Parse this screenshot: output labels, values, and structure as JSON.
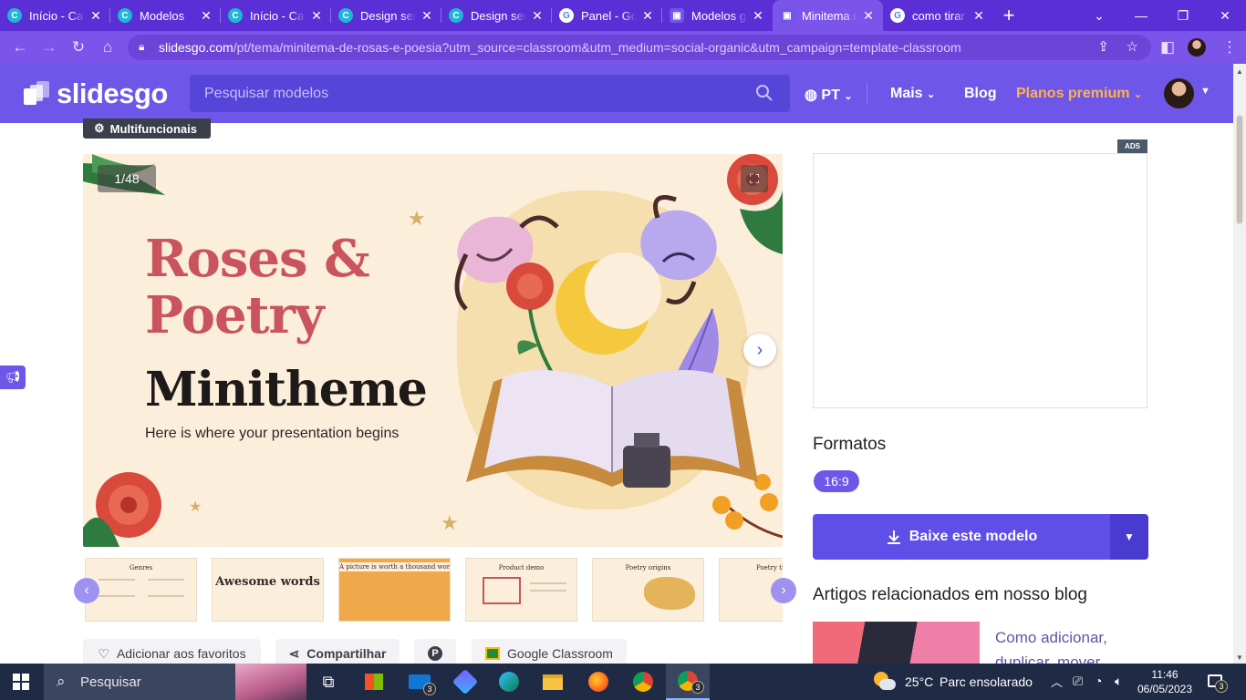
{
  "browser": {
    "tabs": [
      {
        "title": "Início - Canva",
        "icon": "canva-icon",
        "active": false
      },
      {
        "title": "Modelos",
        "icon": "canva-icon",
        "active": false
      },
      {
        "title": "Início - Canva",
        "icon": "canva-icon",
        "active": false
      },
      {
        "title": "Design sem nome",
        "icon": "canva-icon",
        "active": false
      },
      {
        "title": "Design sem nome",
        "icon": "canva-icon",
        "active": false
      },
      {
        "title": "Panel - Google",
        "icon": "google-icon",
        "active": false
      },
      {
        "title": "Modelos gratuitos",
        "icon": "slidesgo-icon",
        "active": false
      },
      {
        "title": "Minitema de rosas",
        "icon": "slidesgo-icon",
        "active": true
      },
      {
        "title": "como tirar print",
        "icon": "google-icon",
        "active": false
      }
    ],
    "new_tab": "+",
    "url_host": "slidesgo.com",
    "url_path": "/pt/tema/minitema-de-rosas-e-poesia?utm_source=classroom&utm_medium=social-organic&utm_campaign=template-classroom"
  },
  "header": {
    "logo_text": "slidesgo",
    "search_placeholder": "Pesquisar modelos",
    "language": "PT",
    "more": "Mais",
    "blog": "Blog",
    "premium": "Planos premium"
  },
  "content": {
    "category_tag": "Multifuncionais",
    "slide_counter": "1/48",
    "slide": {
      "title_line1": "Roses &",
      "title_line2": "Poetry",
      "title_line3": "Minitheme",
      "subtitle": "Here is where your presentation begins"
    },
    "thumbnails": [
      {
        "title": "Genres"
      },
      {
        "title": "Awesome words"
      },
      {
        "title": "A picture is worth a thousand words"
      },
      {
        "title": "Product demo"
      },
      {
        "title": "Poetry origins"
      },
      {
        "title": "Poetry time"
      }
    ],
    "actions": {
      "favorite": "Adicionar aos favoritos",
      "share": "Compartilhar",
      "classroom": "Google Classroom"
    }
  },
  "sidebar": {
    "ads_label": "ADS",
    "formats_heading": "Formatos",
    "format_ratio": "16:9",
    "download_label": "Baixe este modelo",
    "blog_heading": "Artigos relacionados em nosso blog",
    "blog_article_title": "Como adicionar, duplicar, mover"
  },
  "taskbar": {
    "search_placeholder": "Pesquisar",
    "mail_badge": "3",
    "chrome_badge": "3",
    "weather_temp": "25°C",
    "weather_desc": "Parc ensolarado",
    "time": "11:46",
    "date": "06/05/2023",
    "notif_badge": "3"
  },
  "colors": {
    "brand": "#6e57e8",
    "download": "#5f4ee8",
    "premium": "#ffb347",
    "slide_title_red": "#c9545e"
  }
}
